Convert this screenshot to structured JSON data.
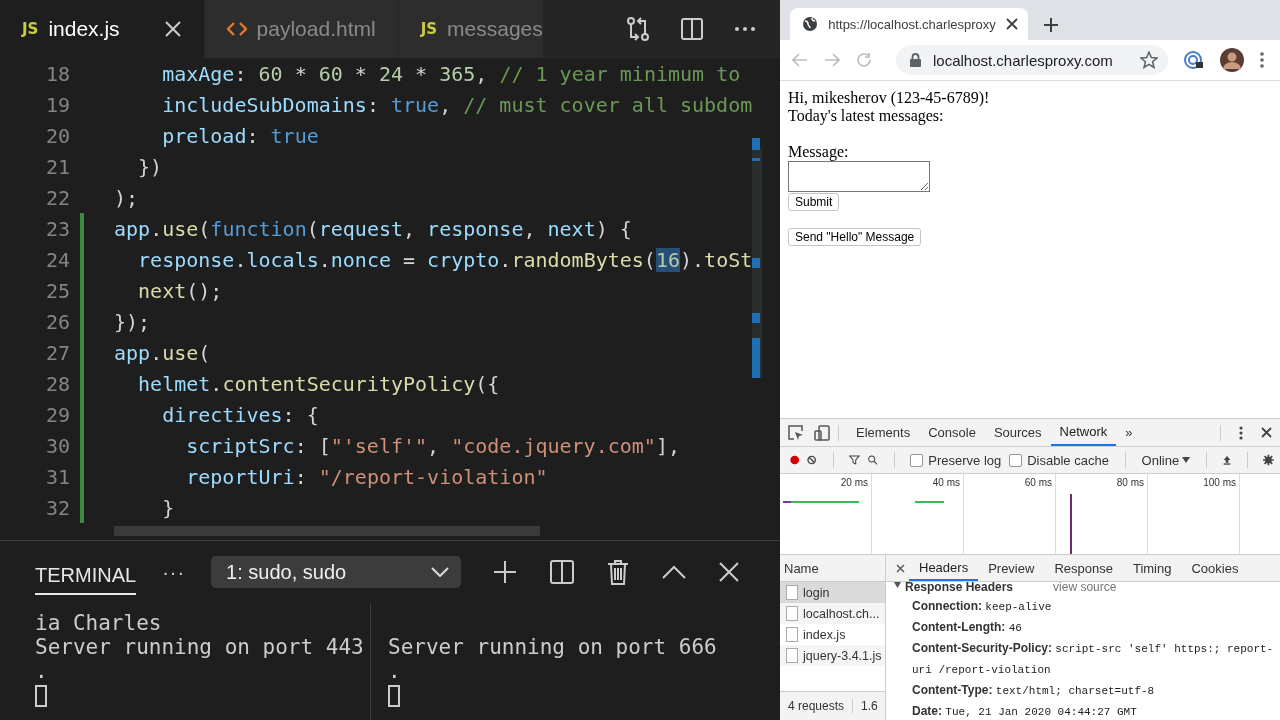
{
  "editor": {
    "tabs": [
      {
        "label": "index.js",
        "kind": "js",
        "badge": "JS",
        "selected": true
      },
      {
        "label": "payload.html",
        "kind": "html",
        "selected": false
      },
      {
        "label": "messages",
        "kind": "js",
        "badge": "JS",
        "selected": false
      }
    ],
    "lines": [
      {
        "number": "18",
        "changed": false,
        "tokens": [
          {
            "text": "    maxAge",
            "kind": "prop"
          },
          {
            "text": ": ",
            "kind": "p"
          },
          {
            "text": "60",
            "kind": "num"
          },
          {
            "text": " * ",
            "kind": "p"
          },
          {
            "text": "60",
            "kind": "num"
          },
          {
            "text": " * ",
            "kind": "p"
          },
          {
            "text": "24",
            "kind": "num"
          },
          {
            "text": " * ",
            "kind": "p"
          },
          {
            "text": "365",
            "kind": "num"
          },
          {
            "text": ", ",
            "kind": "p"
          },
          {
            "text": "// 1 year minimum to",
            "kind": "com"
          }
        ]
      },
      {
        "number": "19",
        "changed": false,
        "tokens": [
          {
            "text": "    includeSubDomains",
            "kind": "prop"
          },
          {
            "text": ": ",
            "kind": "p"
          },
          {
            "text": "true",
            "kind": "kw"
          },
          {
            "text": ", ",
            "kind": "p"
          },
          {
            "text": "// must cover all subdom",
            "kind": "com"
          }
        ]
      },
      {
        "number": "20",
        "changed": false,
        "tokens": [
          {
            "text": "    preload",
            "kind": "prop"
          },
          {
            "text": ": ",
            "kind": "p"
          },
          {
            "text": "true",
            "kind": "kw"
          }
        ]
      },
      {
        "number": "21",
        "changed": false,
        "tokens": [
          {
            "text": "  })",
            "kind": "p"
          }
        ]
      },
      {
        "number": "22",
        "changed": false,
        "tokens": [
          {
            "text": ");",
            "kind": "p"
          }
        ]
      },
      {
        "number": "23",
        "changed": true,
        "tokens": [
          {
            "text": "app",
            "kind": "var"
          },
          {
            "text": ".",
            "kind": "p"
          },
          {
            "text": "use",
            "kind": "fn"
          },
          {
            "text": "(",
            "kind": "p"
          },
          {
            "text": "function",
            "kind": "kw"
          },
          {
            "text": "(",
            "kind": "p"
          },
          {
            "text": "request",
            "kind": "var"
          },
          {
            "text": ", ",
            "kind": "p"
          },
          {
            "text": "response",
            "kind": "var"
          },
          {
            "text": ", ",
            "kind": "p"
          },
          {
            "text": "next",
            "kind": "var"
          },
          {
            "text": ") {",
            "kind": "p"
          }
        ]
      },
      {
        "number": "24",
        "changed": true,
        "tokens": [
          {
            "text": "  response",
            "kind": "var"
          },
          {
            "text": ".",
            "kind": "p"
          },
          {
            "text": "locals",
            "kind": "var"
          },
          {
            "text": ".",
            "kind": "p"
          },
          {
            "text": "nonce",
            "kind": "var"
          },
          {
            "text": " = ",
            "kind": "p"
          },
          {
            "text": "crypto",
            "kind": "var"
          },
          {
            "text": ".",
            "kind": "p"
          },
          {
            "text": "randomBytes",
            "kind": "fn"
          },
          {
            "text": "(",
            "kind": "p"
          },
          {
            "text": "16",
            "kind": "match"
          },
          {
            "text": ").",
            "kind": "p"
          },
          {
            "text": "toSt",
            "kind": "fn"
          }
        ]
      },
      {
        "number": "25",
        "changed": true,
        "tokens": [
          {
            "text": "  next",
            "kind": "fn"
          },
          {
            "text": "();",
            "kind": "p"
          }
        ]
      },
      {
        "number": "26",
        "changed": true,
        "tokens": [
          {
            "text": "});",
            "kind": "p"
          }
        ]
      },
      {
        "number": "27",
        "changed": true,
        "tokens": [
          {
            "text": "app",
            "kind": "var"
          },
          {
            "text": ".",
            "kind": "p"
          },
          {
            "text": "use",
            "kind": "fn"
          },
          {
            "text": "(",
            "kind": "p"
          }
        ]
      },
      {
        "number": "28",
        "changed": true,
        "tokens": [
          {
            "text": "  helmet",
            "kind": "var"
          },
          {
            "text": ".",
            "kind": "p"
          },
          {
            "text": "contentSecurityPolicy",
            "kind": "fn"
          },
          {
            "text": "({",
            "kind": "p"
          }
        ]
      },
      {
        "number": "29",
        "changed": true,
        "tokens": [
          {
            "text": "    directives",
            "kind": "prop"
          },
          {
            "text": ": {",
            "kind": "p"
          }
        ]
      },
      {
        "number": "30",
        "changed": true,
        "tokens": [
          {
            "text": "      scriptSrc",
            "kind": "prop"
          },
          {
            "text": ": [",
            "kind": "p"
          },
          {
            "text": "\"'self'\"",
            "kind": "str"
          },
          {
            "text": ", ",
            "kind": "p"
          },
          {
            "text": "\"code.jquery.com\"",
            "kind": "str"
          },
          {
            "text": "],",
            "kind": "p"
          }
        ]
      },
      {
        "number": "31",
        "changed": true,
        "tokens": [
          {
            "text": "      reportUri",
            "kind": "prop"
          },
          {
            "text": ": ",
            "kind": "p"
          },
          {
            "text": "\"/report-violation\"",
            "kind": "str"
          }
        ]
      },
      {
        "number": "32",
        "changed": true,
        "tokens": [
          {
            "text": "    }",
            "kind": "p"
          }
        ]
      }
    ]
  },
  "terminal": {
    "title": "TERMINAL",
    "more": "···",
    "instance": "1: sudo, sudo",
    "panes": [
      {
        "lines": [
          "ia Charles",
          "Server running on port 443",
          "."
        ]
      },
      {
        "lines": [
          "Server running on port 666",
          "."
        ]
      }
    ]
  },
  "browser": {
    "tab_title": "https://localhost.charlesproxy",
    "address": "localhost.charlesproxy.com",
    "page": {
      "greeting": "Hi, mikesherov (123-45-6789)!",
      "subtitle": "Today's latest messages:",
      "message_label": "Message:",
      "buttons": [
        "Submit",
        "Send \"Hello\" Message"
      ]
    }
  },
  "devtools": {
    "tabs": [
      {
        "label": "Elements",
        "selected": false
      },
      {
        "label": "Console",
        "selected": false
      },
      {
        "label": "Sources",
        "selected": false
      },
      {
        "label": "Network",
        "selected": true
      }
    ],
    "more": "»",
    "options": [
      {
        "label": "Preserve log",
        "checked": false
      },
      {
        "label": "Disable cache",
        "checked": false
      }
    ],
    "throttle": "Online",
    "ticks": [
      "20 ms",
      "40 ms",
      "60 ms",
      "80 ms",
      "100 ms"
    ],
    "name_header": "Name",
    "requests": [
      {
        "name": "login",
        "selected": true
      },
      {
        "name": "localhost.ch...",
        "selected": false
      },
      {
        "name": "index.js",
        "selected": false
      },
      {
        "name": "jquery-3.4.1.js",
        "selected": false
      }
    ],
    "summary": [
      "4 requests",
      "1.6"
    ],
    "detail_tabs": [
      {
        "label": "Headers",
        "selected": true
      },
      {
        "label": "Preview",
        "selected": false
      },
      {
        "label": "Response",
        "selected": false
      },
      {
        "label": "Timing",
        "selected": false
      },
      {
        "label": "Cookies",
        "selected": false
      }
    ],
    "section": {
      "title": "Response Headers",
      "link": "view source"
    },
    "headers": [
      {
        "name": "Connection:",
        "value": "keep-alive"
      },
      {
        "name": "Content-Length:",
        "value": "46"
      },
      {
        "name": "Content-Security-Policy:",
        "value": "script-src 'self' https:; report-uri /report-violation"
      },
      {
        "name": "Content-Type:",
        "value": "text/html; charset=utf-8"
      },
      {
        "name": "Date:",
        "value": "Tue, 21 Jan 2020 04:44:27 GMT"
      }
    ]
  }
}
